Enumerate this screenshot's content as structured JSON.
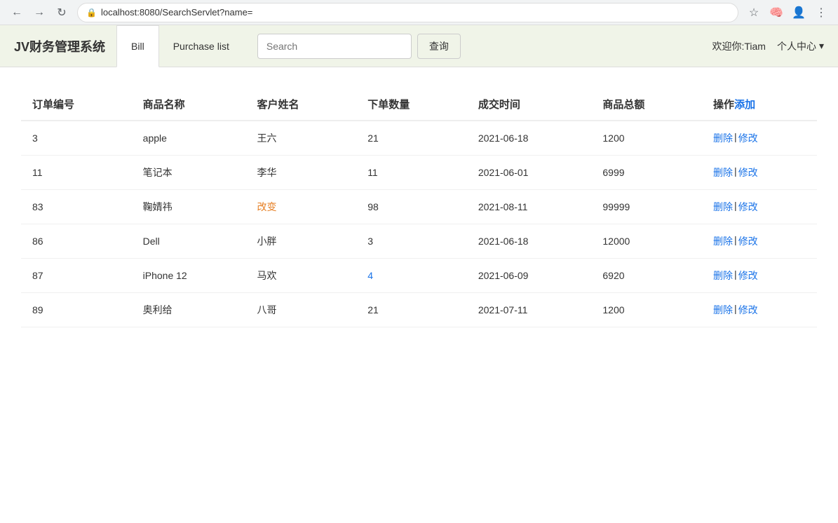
{
  "browser": {
    "url": "localhost:8080/SearchServlet?name=",
    "nav": {
      "back": "←",
      "forward": "→",
      "reload": "↻"
    }
  },
  "header": {
    "app_title": "JV财务管理系统",
    "tabs": [
      {
        "label": "Bill",
        "active": true
      },
      {
        "label": "Purchase list",
        "active": false
      }
    ],
    "search": {
      "placeholder": "Search",
      "button_label": "查询"
    },
    "welcome": "欢迎你:Tiam",
    "user_menu": "个人中心",
    "dropdown_icon": "▾"
  },
  "table": {
    "columns": [
      {
        "key": "id",
        "label": "订单编号"
      },
      {
        "key": "product",
        "label": "商品名称"
      },
      {
        "key": "customer",
        "label": "客户姓名"
      },
      {
        "key": "quantity",
        "label": "下单数量"
      },
      {
        "key": "date",
        "label": "成交时间"
      },
      {
        "key": "total",
        "label": "商品总额"
      },
      {
        "key": "actions",
        "label": "操作",
        "add_label": "添加"
      }
    ],
    "rows": [
      {
        "id": "3",
        "product": "apple",
        "customer": "王六",
        "quantity": "21",
        "date": "2021-06-18",
        "total": "1200",
        "customer_highlight": false
      },
      {
        "id": "11",
        "product": "笔记本",
        "customer": "李华",
        "quantity": "11",
        "date": "2021-06-01",
        "total": "6999",
        "customer_highlight": false
      },
      {
        "id": "83",
        "product": "鞠婧祎",
        "customer": "改变",
        "quantity": "98",
        "date": "2021-08-11",
        "total": "99999",
        "customer_highlight": true
      },
      {
        "id": "86",
        "product": "Dell",
        "customer": "小胖",
        "quantity": "3",
        "date": "2021-06-18",
        "total": "12000",
        "customer_highlight": false
      },
      {
        "id": "87",
        "product": "iPhone 12",
        "customer": "马欢",
        "quantity": "4",
        "date": "2021-06-09",
        "total": "6920",
        "quantity_highlight": true
      },
      {
        "id": "89",
        "product": "奥利给",
        "customer": "八哥",
        "quantity": "21",
        "date": "2021-07-11",
        "total": "1200",
        "customer_highlight": false
      }
    ],
    "action_delete": "删除",
    "action_separator": "|",
    "action_edit": "修改"
  }
}
